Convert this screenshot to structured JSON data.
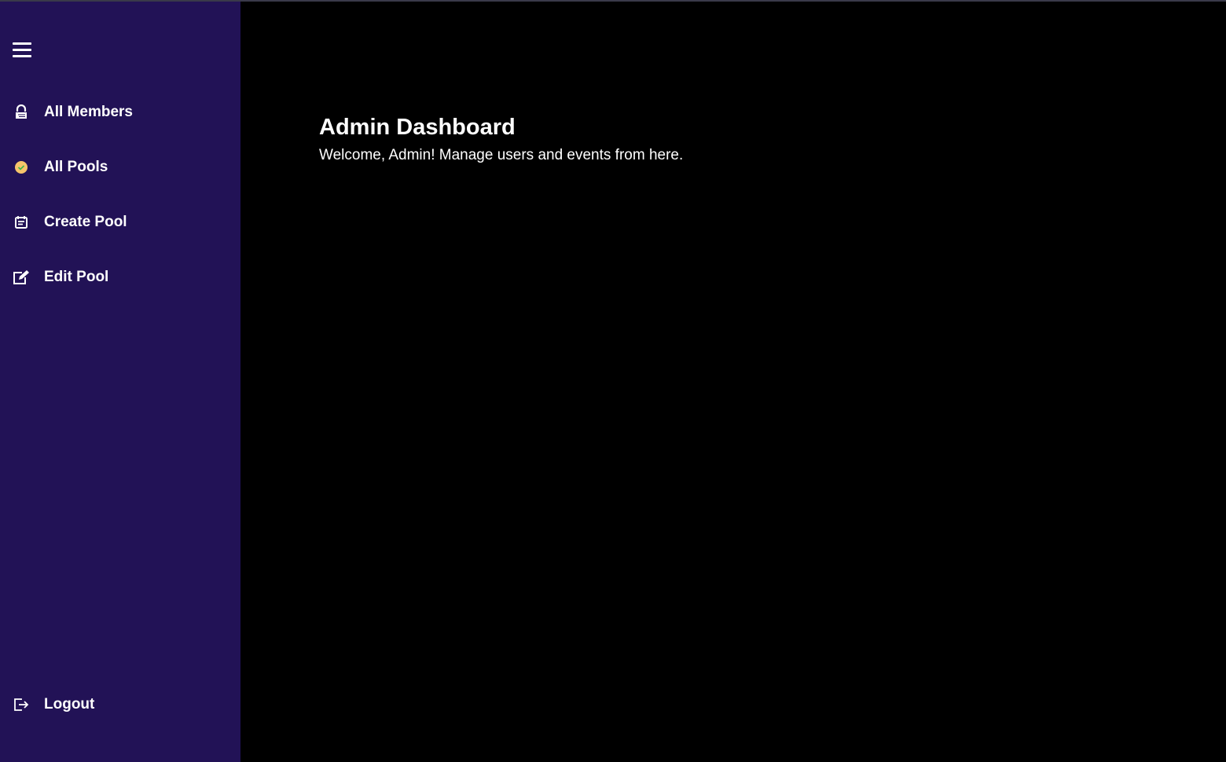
{
  "sidebar": {
    "items": [
      {
        "label": "All Members",
        "icon": "members-icon"
      },
      {
        "label": "All Pools",
        "icon": "check-badge-icon"
      },
      {
        "label": "Create Pool",
        "icon": "calendar-icon"
      },
      {
        "label": "Edit Pool",
        "icon": "edit-icon"
      }
    ],
    "logout": {
      "label": "Logout",
      "icon": "logout-icon"
    }
  },
  "main": {
    "title": "Admin Dashboard",
    "subtitle": "Welcome, Admin! Manage users and events from here."
  },
  "colors": {
    "sidebar": "#221256",
    "background": "#000000",
    "accent": "#f6c46b"
  }
}
